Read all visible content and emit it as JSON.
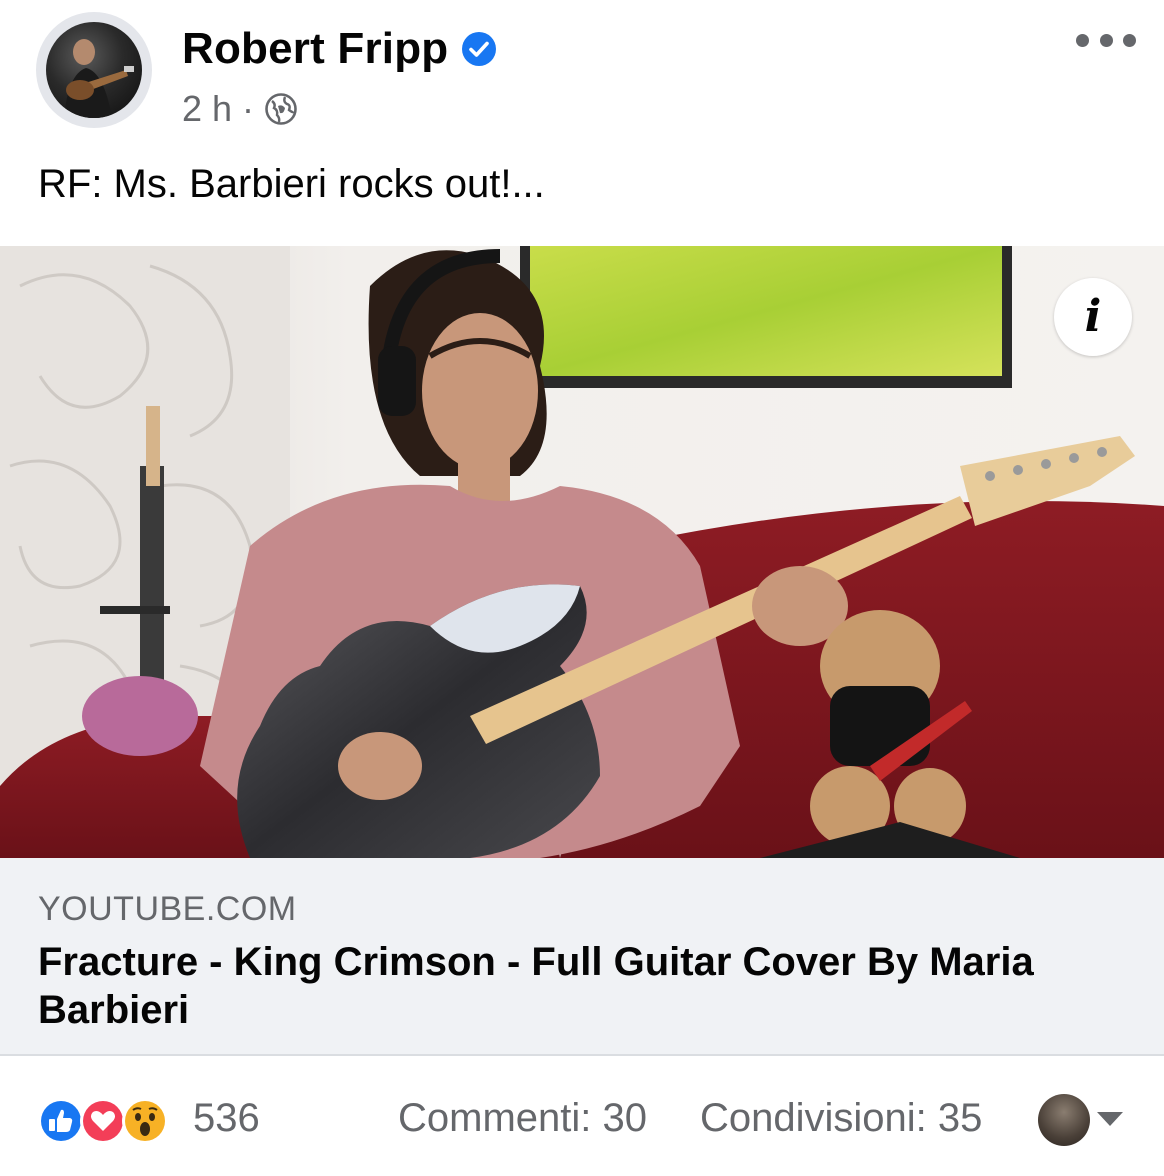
{
  "post": {
    "author": "Robert Fripp",
    "time": "2 h",
    "separator": "·",
    "verified_icon": "verified-badge-icon",
    "privacy_icon": "globe-icon",
    "more_icon": "more-options-icon",
    "text": "RF: Ms. Barbieri rocks out!..."
  },
  "media": {
    "info_label": "i"
  },
  "link": {
    "domain": "YOUTUBE.COM",
    "title": "Fracture - King Crimson - Full Guitar Cover By Maria Barbieri"
  },
  "footer": {
    "reaction_icons": [
      "like-icon",
      "love-icon",
      "wow-icon"
    ],
    "reaction_count": "536",
    "comments": "Commenti: 30",
    "shares": "Condivisioni: 35"
  },
  "colors": {
    "like": "#1877f2",
    "love": "#f33e58",
    "wow": "#f7b125",
    "muted_text": "#65676b",
    "card_bg": "#f0f2f5"
  }
}
